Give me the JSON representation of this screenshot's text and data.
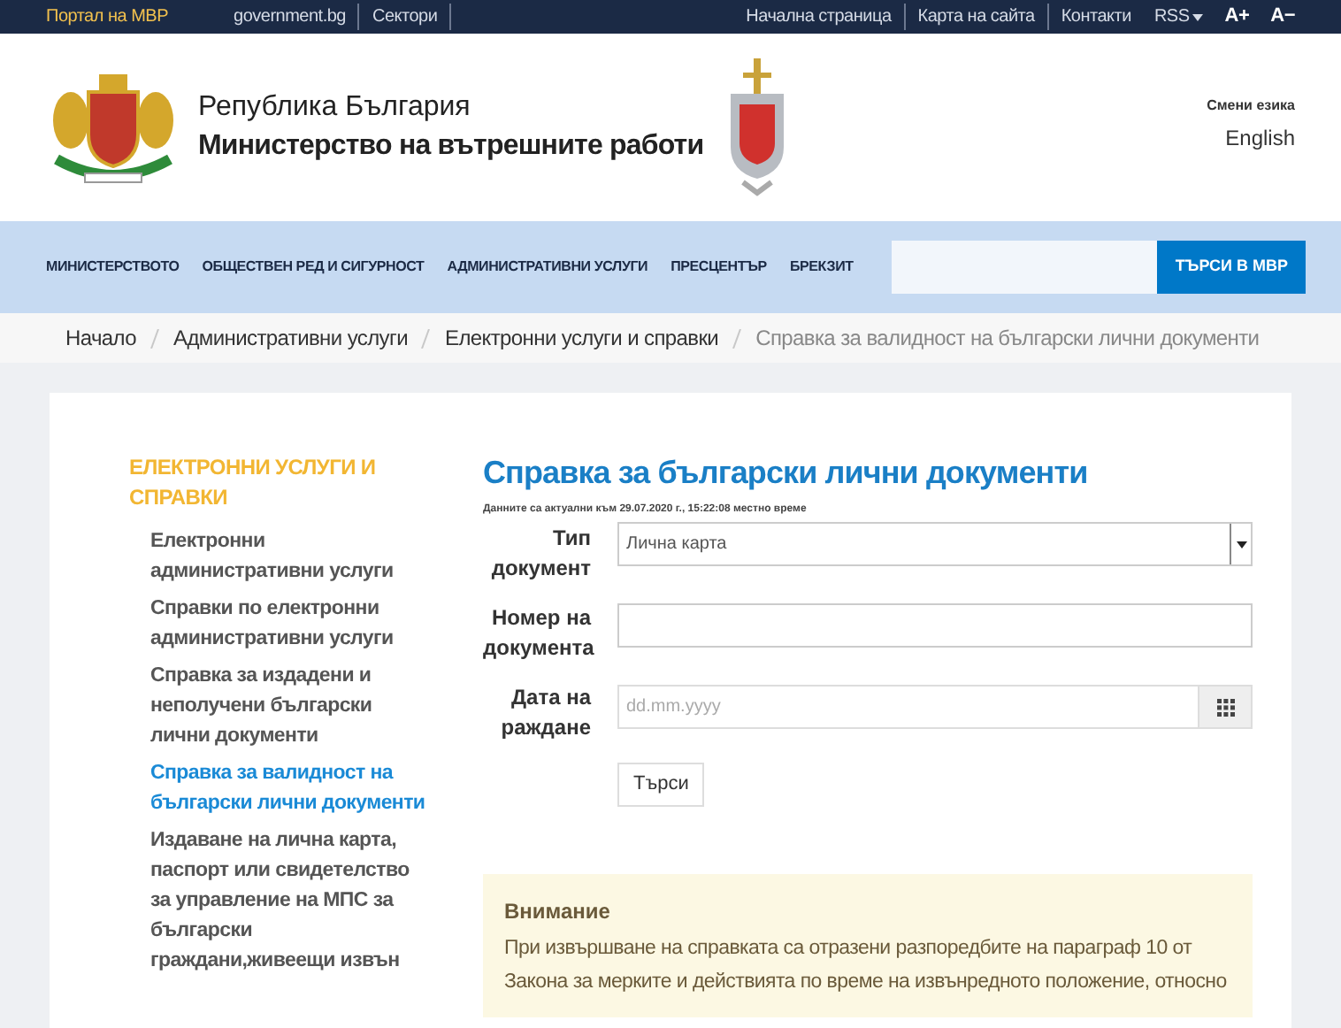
{
  "topbar": {
    "left": [
      {
        "label": "Портал на МВР",
        "selected": true
      },
      {
        "label": "government.bg",
        "selected": false
      },
      {
        "label": "Сектори",
        "selected": false
      }
    ],
    "right": [
      "Начална страница",
      "Карта на сайта",
      "Контакти"
    ],
    "rss": "RSS",
    "font_up": "A+",
    "font_down": "A−"
  },
  "header": {
    "line1": "Република България",
    "line2": "Министерство на вътрешните работи",
    "lang_label": "Смени езика",
    "lang": "English"
  },
  "nav": {
    "items": [
      "МИНИСТЕРСТВОТО",
      "ОБЩЕСТВЕН РЕД И СИГУРНОСТ",
      "АДМИНИСТРАТИВНИ УСЛУГИ",
      "ПРЕСЦЕНТЪР",
      "БРЕКЗИТ"
    ],
    "search_button": "ТЪРСИ В МВР"
  },
  "breadcrumb": [
    "Начало",
    "Административни услуги",
    "Електронни услуги и справки",
    "Справка за валидност на български лични документи"
  ],
  "sidebar": {
    "title": "ЕЛЕКТРОННИ УСЛУГИ И СПРАВКИ",
    "items": [
      {
        "label": "Електронни административни услуги",
        "selected": false
      },
      {
        "label": "Справки по електронни административни услуги",
        "selected": false
      },
      {
        "label": "Справка за издадени и неполучени български лични документи",
        "selected": false
      },
      {
        "label": "Справка за валидност на български лични документи",
        "selected": true
      },
      {
        "label": "Издаване на лична карта, паспорт или свидетелство за управление на МПС за български граждани,живеещи извън",
        "selected": false
      }
    ]
  },
  "main": {
    "title": "Справка за български лични документи",
    "updated": "Данните са актуални към 29.07.2020 г., 15:22:08 местно време",
    "fields": [
      {
        "kind": "select",
        "label": "Тип документ",
        "value": "Лична карта"
      },
      {
        "kind": "text",
        "label": "Номер на документа"
      },
      {
        "kind": "date",
        "label": "Дата на раждане",
        "placeholder": "dd.mm.yyyy"
      }
    ],
    "submit": "Търси",
    "notice": {
      "title": "Внимание",
      "text": "При извършване на справката са отразени разпоредбите на параграф 10 от Закона за мерките и действията по време на извънредното положение, относно"
    }
  }
}
